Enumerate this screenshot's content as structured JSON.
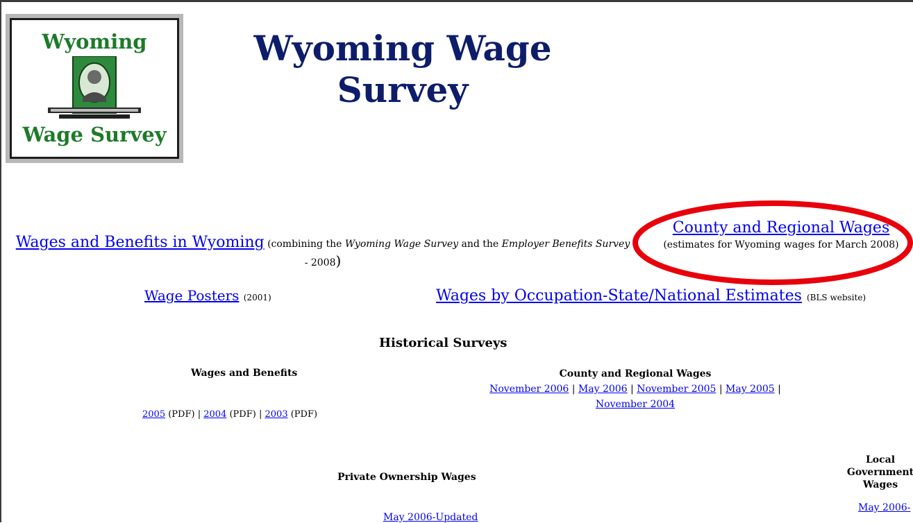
{
  "logo": {
    "top_text": "Wyoming",
    "bottom_text": "Wage Survey",
    "colors": {
      "text": "#1e7a2a",
      "bill": "#2d8a3c"
    }
  },
  "title": "Wyoming Wage Survey",
  "main_links": {
    "wages_benefits": {
      "label": "Wages and Benefits in Wyoming",
      "desc_prefix": "(combining the",
      "desc_italic1": "Wyoming Wage Survey",
      "desc_mid": "and the",
      "desc_italic2": "Employer Benefits Survey",
      "desc_suffix": "- 2008",
      "desc_close": ")"
    },
    "county_regional": {
      "label": "County and Regional Wages",
      "desc": "(estimates for Wyoming wages for March 2008)"
    },
    "posters": {
      "label": "Wage Posters",
      "note": "(2001)"
    },
    "occupation": {
      "label": "Wages by Occupation-State/National Estimates",
      "note": "(BLS website)"
    }
  },
  "historical": {
    "title": "Historical Surveys",
    "wages_benefits": {
      "heading": "Wages and Benefits",
      "items": [
        {
          "year": "2005",
          "format": "(PDF)"
        },
        {
          "year": "2004",
          "format": "(PDF)"
        },
        {
          "year": "2003",
          "format": "(PDF)"
        }
      ],
      "separator": "|"
    },
    "county_regional": {
      "heading": "County and Regional Wages",
      "links": [
        "November 2006",
        "May 2006",
        "November 2005",
        "May 2005",
        "November 2004"
      ],
      "separator": "|"
    },
    "private": {
      "heading": "Private Ownership Wages",
      "link": "May 2006-Updated"
    },
    "local_gov": {
      "heading_line1": "Local",
      "heading_line2": "Government",
      "heading_line3": "Wages",
      "link": "May 2006-"
    }
  },
  "colors": {
    "title": "#0d1d6a",
    "link": "#0000ee",
    "highlight": "#e8000b"
  }
}
